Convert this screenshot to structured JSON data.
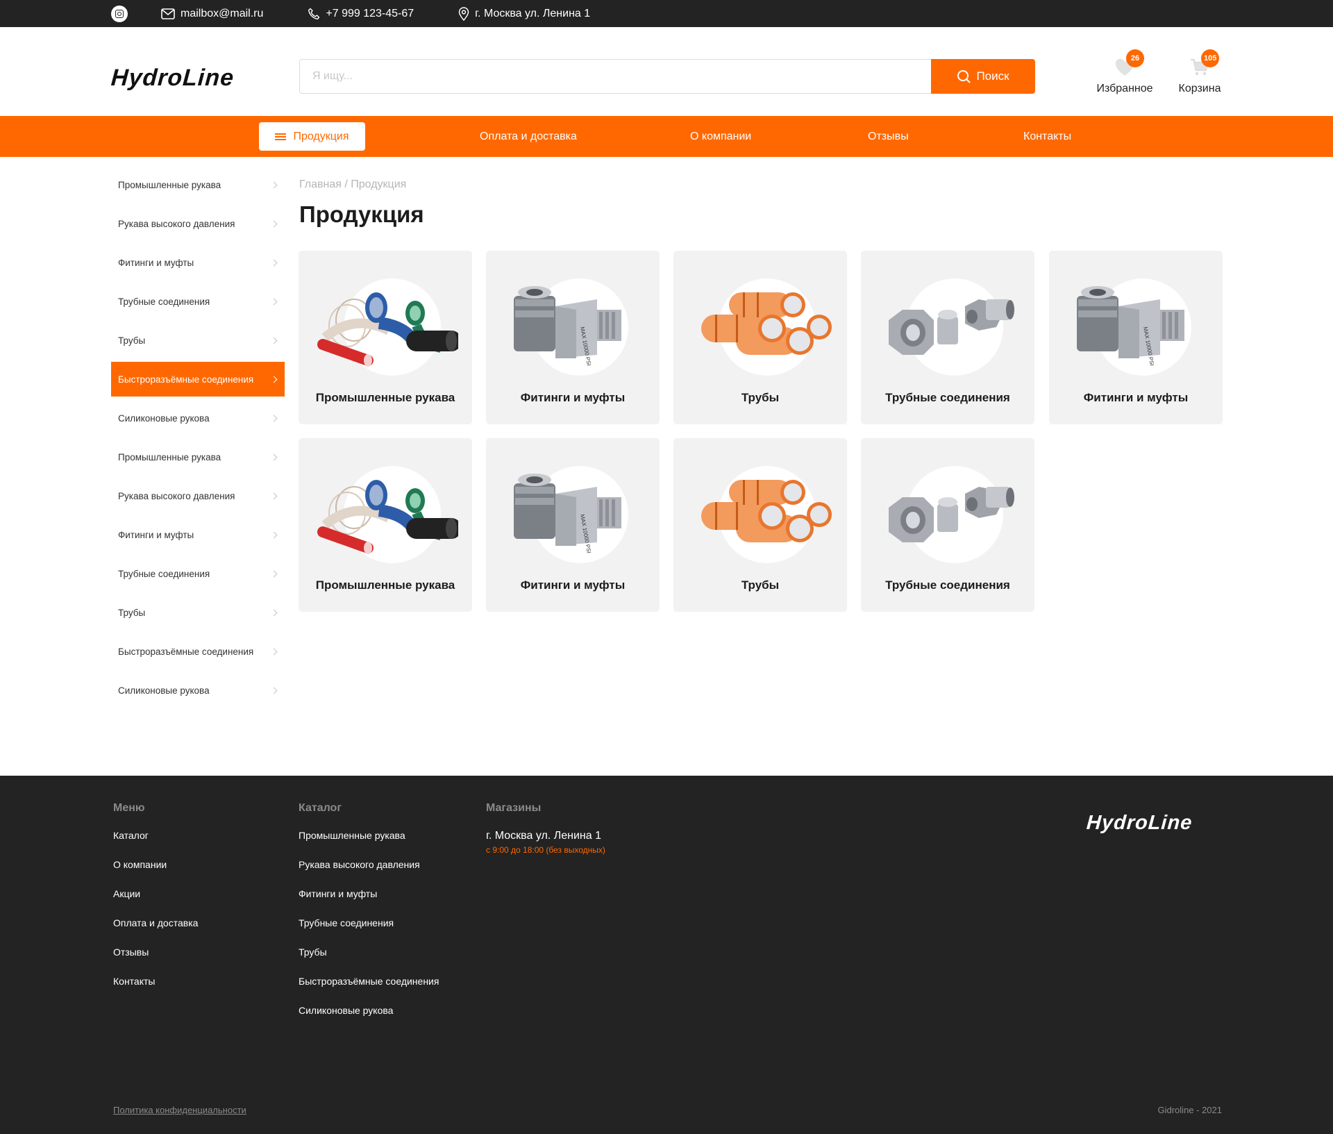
{
  "topbar": {
    "email": "mailbox@mail.ru",
    "phone": "+7 999 123-45-67",
    "address": "г. Москва ул. Ленина 1"
  },
  "header": {
    "logo": "HydroLine",
    "search_placeholder": "Я ищу...",
    "search_button": "Поиск",
    "favorites_label": "Избранное",
    "favorites_count": "26",
    "cart_label": "Корзина",
    "cart_count": "105"
  },
  "nav": {
    "products": "Продукция",
    "payment": "Оплата и доставка",
    "about": "О компании",
    "reviews": "Отзывы",
    "contacts": "Контакты"
  },
  "sidebar": {
    "items": [
      "Промышленные рукава",
      "Рукава высокого давления",
      "Фитинги и муфты",
      "Трубные соединения",
      "Трубы",
      "Быстроразъёмные соединения",
      "Силиконовые рукова",
      "Промышленные рукава",
      "Рукава высокого давления",
      "Фитинги и муфты",
      "Трубные соединения",
      "Трубы",
      "Быстроразъёмные соединения",
      "Силиконовые рукова"
    ],
    "active_index": 5
  },
  "breadcrumb": {
    "home": "Главная",
    "sep": " / ",
    "current": "Продукция"
  },
  "page_title": "Продукция",
  "products": [
    {
      "label": "Промышленные рукава",
      "image": "hoses"
    },
    {
      "label": "Фитинги и муфты",
      "image": "fittings"
    },
    {
      "label": "Трубы",
      "image": "pipes"
    },
    {
      "label": "Трубные соединения",
      "image": "connectors"
    },
    {
      "label": "Фитинги и муфты",
      "image": "fittings"
    },
    {
      "label": "Промышленные рукава",
      "image": "hoses"
    },
    {
      "label": "Фитинги и муфты",
      "image": "fittings"
    },
    {
      "label": "Трубы",
      "image": "pipes"
    },
    {
      "label": "Трубные соединения",
      "image": "connectors"
    }
  ],
  "footer": {
    "menu_title": "Меню",
    "menu": [
      "Каталог",
      "О компании",
      "Акции",
      "Оплата и доставка",
      "Отзывы",
      "Контакты"
    ],
    "catalog_title": "Каталог",
    "catalog": [
      "Промышленные рукава",
      "Рукава высокого давления",
      "Фитинги и муфты",
      "Трубные соединения",
      "Трубы",
      "Быстроразъёмные соединения",
      "Силиконовые рукова"
    ],
    "stores_title": "Магазины",
    "store_address": "г. Москва ул. Ленина 1",
    "store_hours": "с 9:00 до 18:00 (без выходных)",
    "logo": "HydroLine",
    "privacy": "Политика конфиденциальности",
    "copyright": "Gidroline - 2021"
  },
  "colors": {
    "accent": "#ff6800",
    "dark": "#232323",
    "card_bg": "#f2f2f2"
  }
}
